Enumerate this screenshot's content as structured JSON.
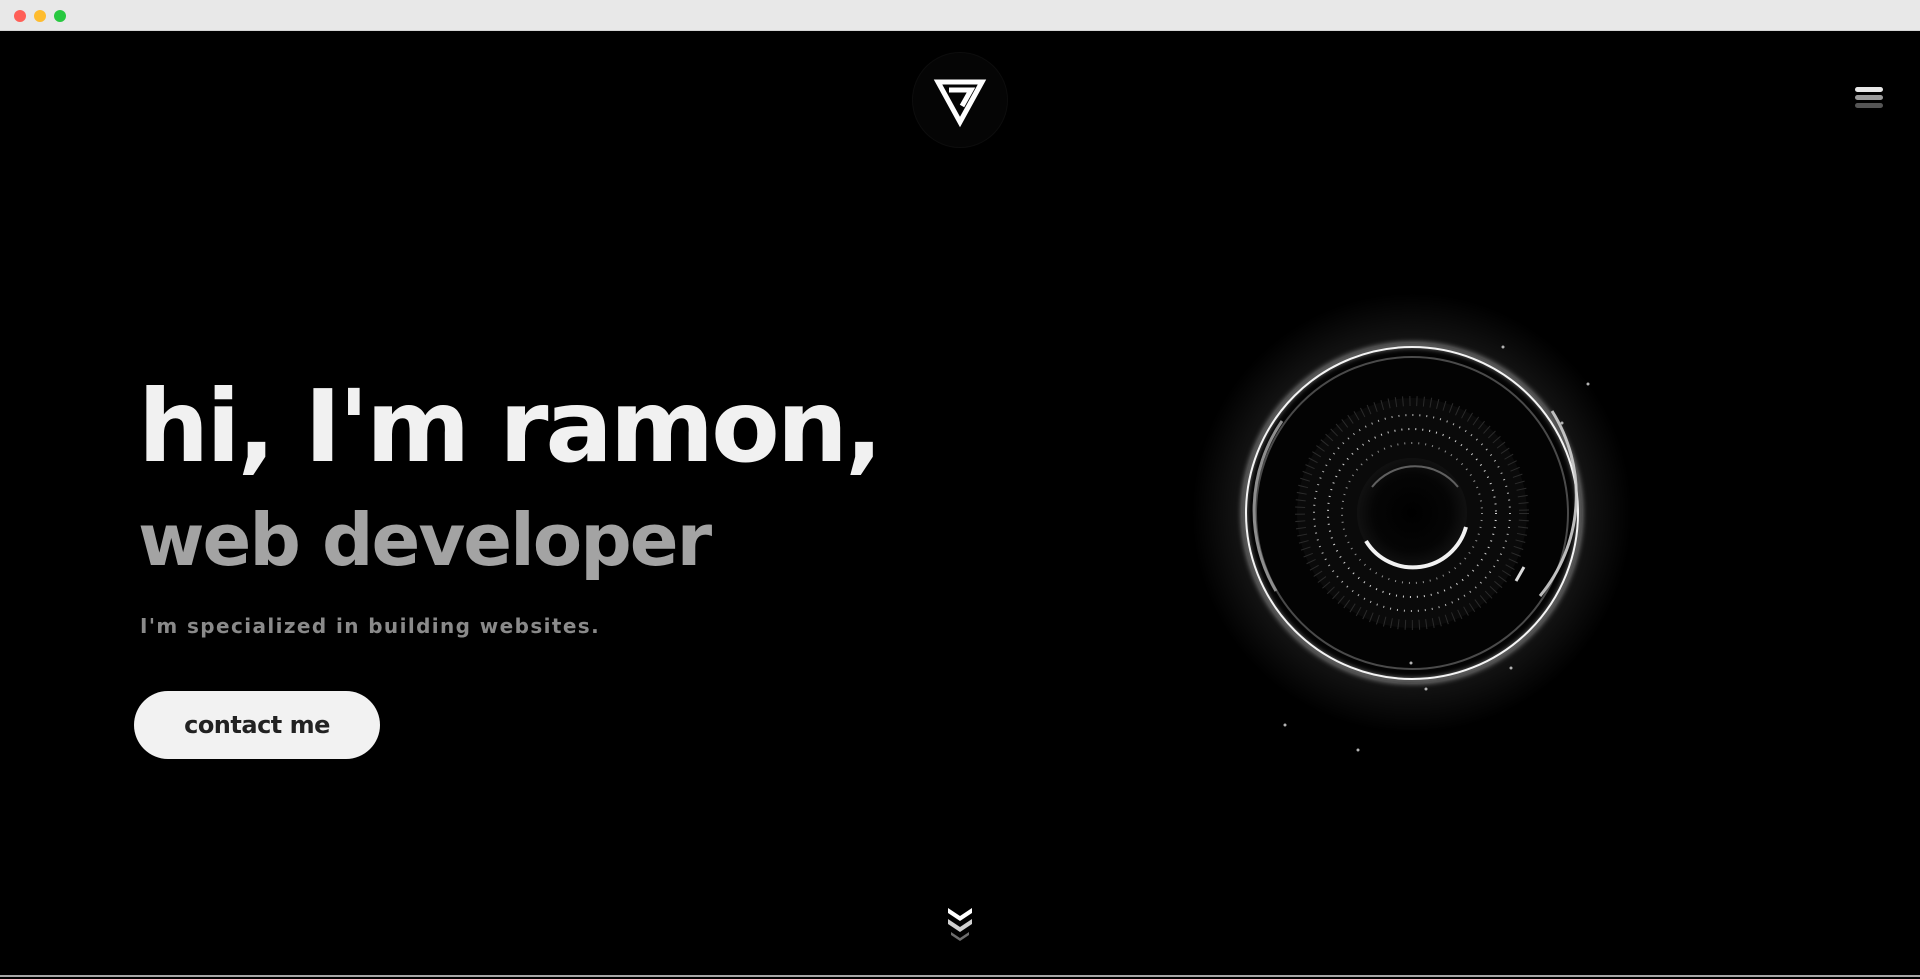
{
  "window": {
    "controls": [
      "close",
      "minimize",
      "maximize"
    ]
  },
  "header": {
    "logo_icon": "triangle-logo-icon",
    "menu_icon": "hamburger-menu-icon"
  },
  "hero": {
    "title": "hi, I'm ramon,",
    "subtitle": "web developer",
    "description": "I'm specialized in building websites.",
    "cta_label": "contact me",
    "visual": "glowing-ring-orb-graphic"
  },
  "scroll": {
    "icon": "double-chevron-down-icon"
  },
  "colors": {
    "background": "#000000",
    "title": "#f1f1f1",
    "subtitle": "#a3a3a3",
    "description": "#8a8a8a",
    "button_bg": "#f2f2f2",
    "button_text": "#222222"
  }
}
